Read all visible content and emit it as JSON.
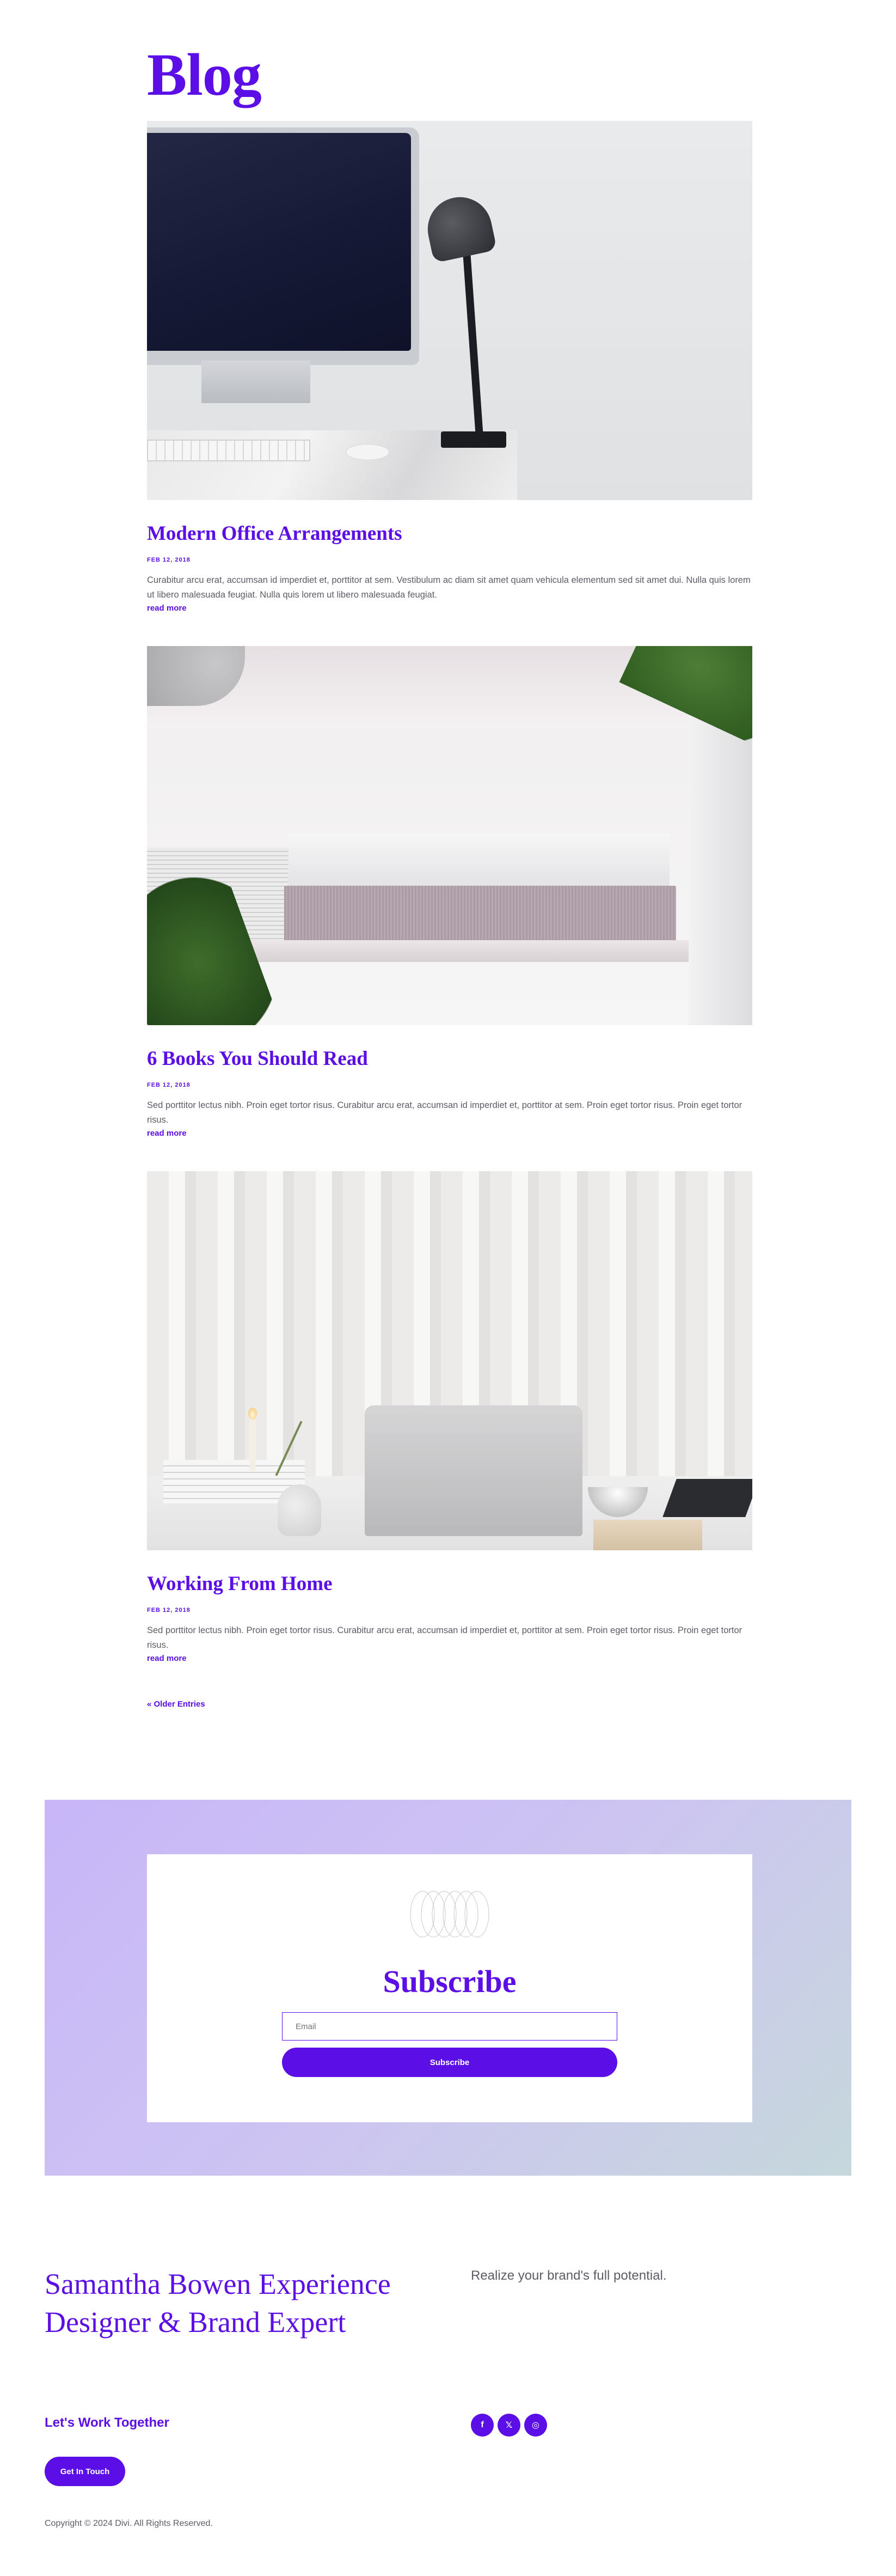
{
  "blog": {
    "title": "Blog"
  },
  "posts": [
    {
      "title": "Modern Office Arrangements",
      "date": "FEB 12, 2018",
      "excerpt": "Curabitur arcu erat, accumsan id imperdiet et, porttitor at sem. Vestibulum ac diam sit amet quam vehicula elementum sed sit amet dui. Nulla quis lorem ut libero malesuada feugiat. Nulla quis lorem ut libero malesuada feugiat.",
      "read_more": "read more"
    },
    {
      "title": "6 Books You Should Read",
      "date": "FEB 12, 2018",
      "excerpt": "Sed porttitor lectus nibh. Proin eget tortor risus. Curabitur arcu erat, accumsan id imperdiet et, porttitor at sem. Proin eget tortor risus. Proin eget tortor risus.",
      "read_more": "read more"
    },
    {
      "title": "Working From Home",
      "date": "FEB 12, 2018",
      "excerpt": "Sed porttitor lectus nibh. Proin eget tortor risus. Curabitur arcu erat, accumsan id imperdiet et, porttitor at sem. Proin eget tortor risus. Proin eget tortor risus.",
      "read_more": "read more"
    }
  ],
  "pagination": {
    "older_entries": "« Older Entries"
  },
  "subscribe": {
    "title": "Subscribe",
    "email_placeholder": "Email",
    "button_label": "Subscribe"
  },
  "footer": {
    "name_line": "Samantha Bowen Experience Designer & Brand Expert",
    "tagline": "Realize your brand's full potential.",
    "cta": "Let's Work Together",
    "button_label": "Get In Touch",
    "social": [
      {
        "icon": "facebook-icon",
        "glyph": "f"
      },
      {
        "icon": "x-icon",
        "glyph": "𝕏"
      },
      {
        "icon": "instagram-icon",
        "glyph": "◎"
      }
    ],
    "copyright": "Copyright © 2024 Divi. All Rights Reserved."
  },
  "colors": {
    "accent": "#5b0ee6",
    "text": "#5c5c66"
  }
}
